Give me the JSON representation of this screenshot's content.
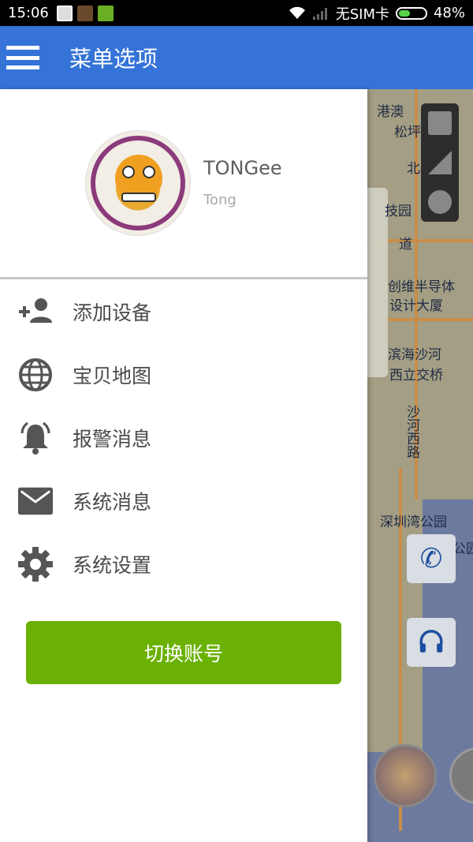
{
  "status_bar": {
    "time": "15:06",
    "carrier": "无SIM卡",
    "battery": "48%",
    "battery_level": 0.48
  },
  "appbar": {
    "title": "菜单选项"
  },
  "profile": {
    "name": "TONGee",
    "subtitle": "Tong"
  },
  "menu": {
    "items": [
      {
        "label": "添加设备",
        "icon": "add-person-icon"
      },
      {
        "label": "宝贝地图",
        "icon": "globe-icon"
      },
      {
        "label": "报警消息",
        "icon": "alarm-bell-icon"
      },
      {
        "label": "系统消息",
        "icon": "mail-icon"
      },
      {
        "label": "系统设置",
        "icon": "gear-icon"
      }
    ]
  },
  "switch_button": {
    "label": "切换账号"
  },
  "map": {
    "labels": [
      "港澳",
      "松坪",
      "北",
      "技园",
      "道",
      "创维半导体",
      "设计大厦",
      "滨海沙河",
      "西立交桥",
      "沙河西路",
      "深圳湾公园",
      "公园"
    ]
  },
  "colors": {
    "appbar": "#3573d8",
    "button": "#6ab103",
    "status_bar": "#000000"
  }
}
